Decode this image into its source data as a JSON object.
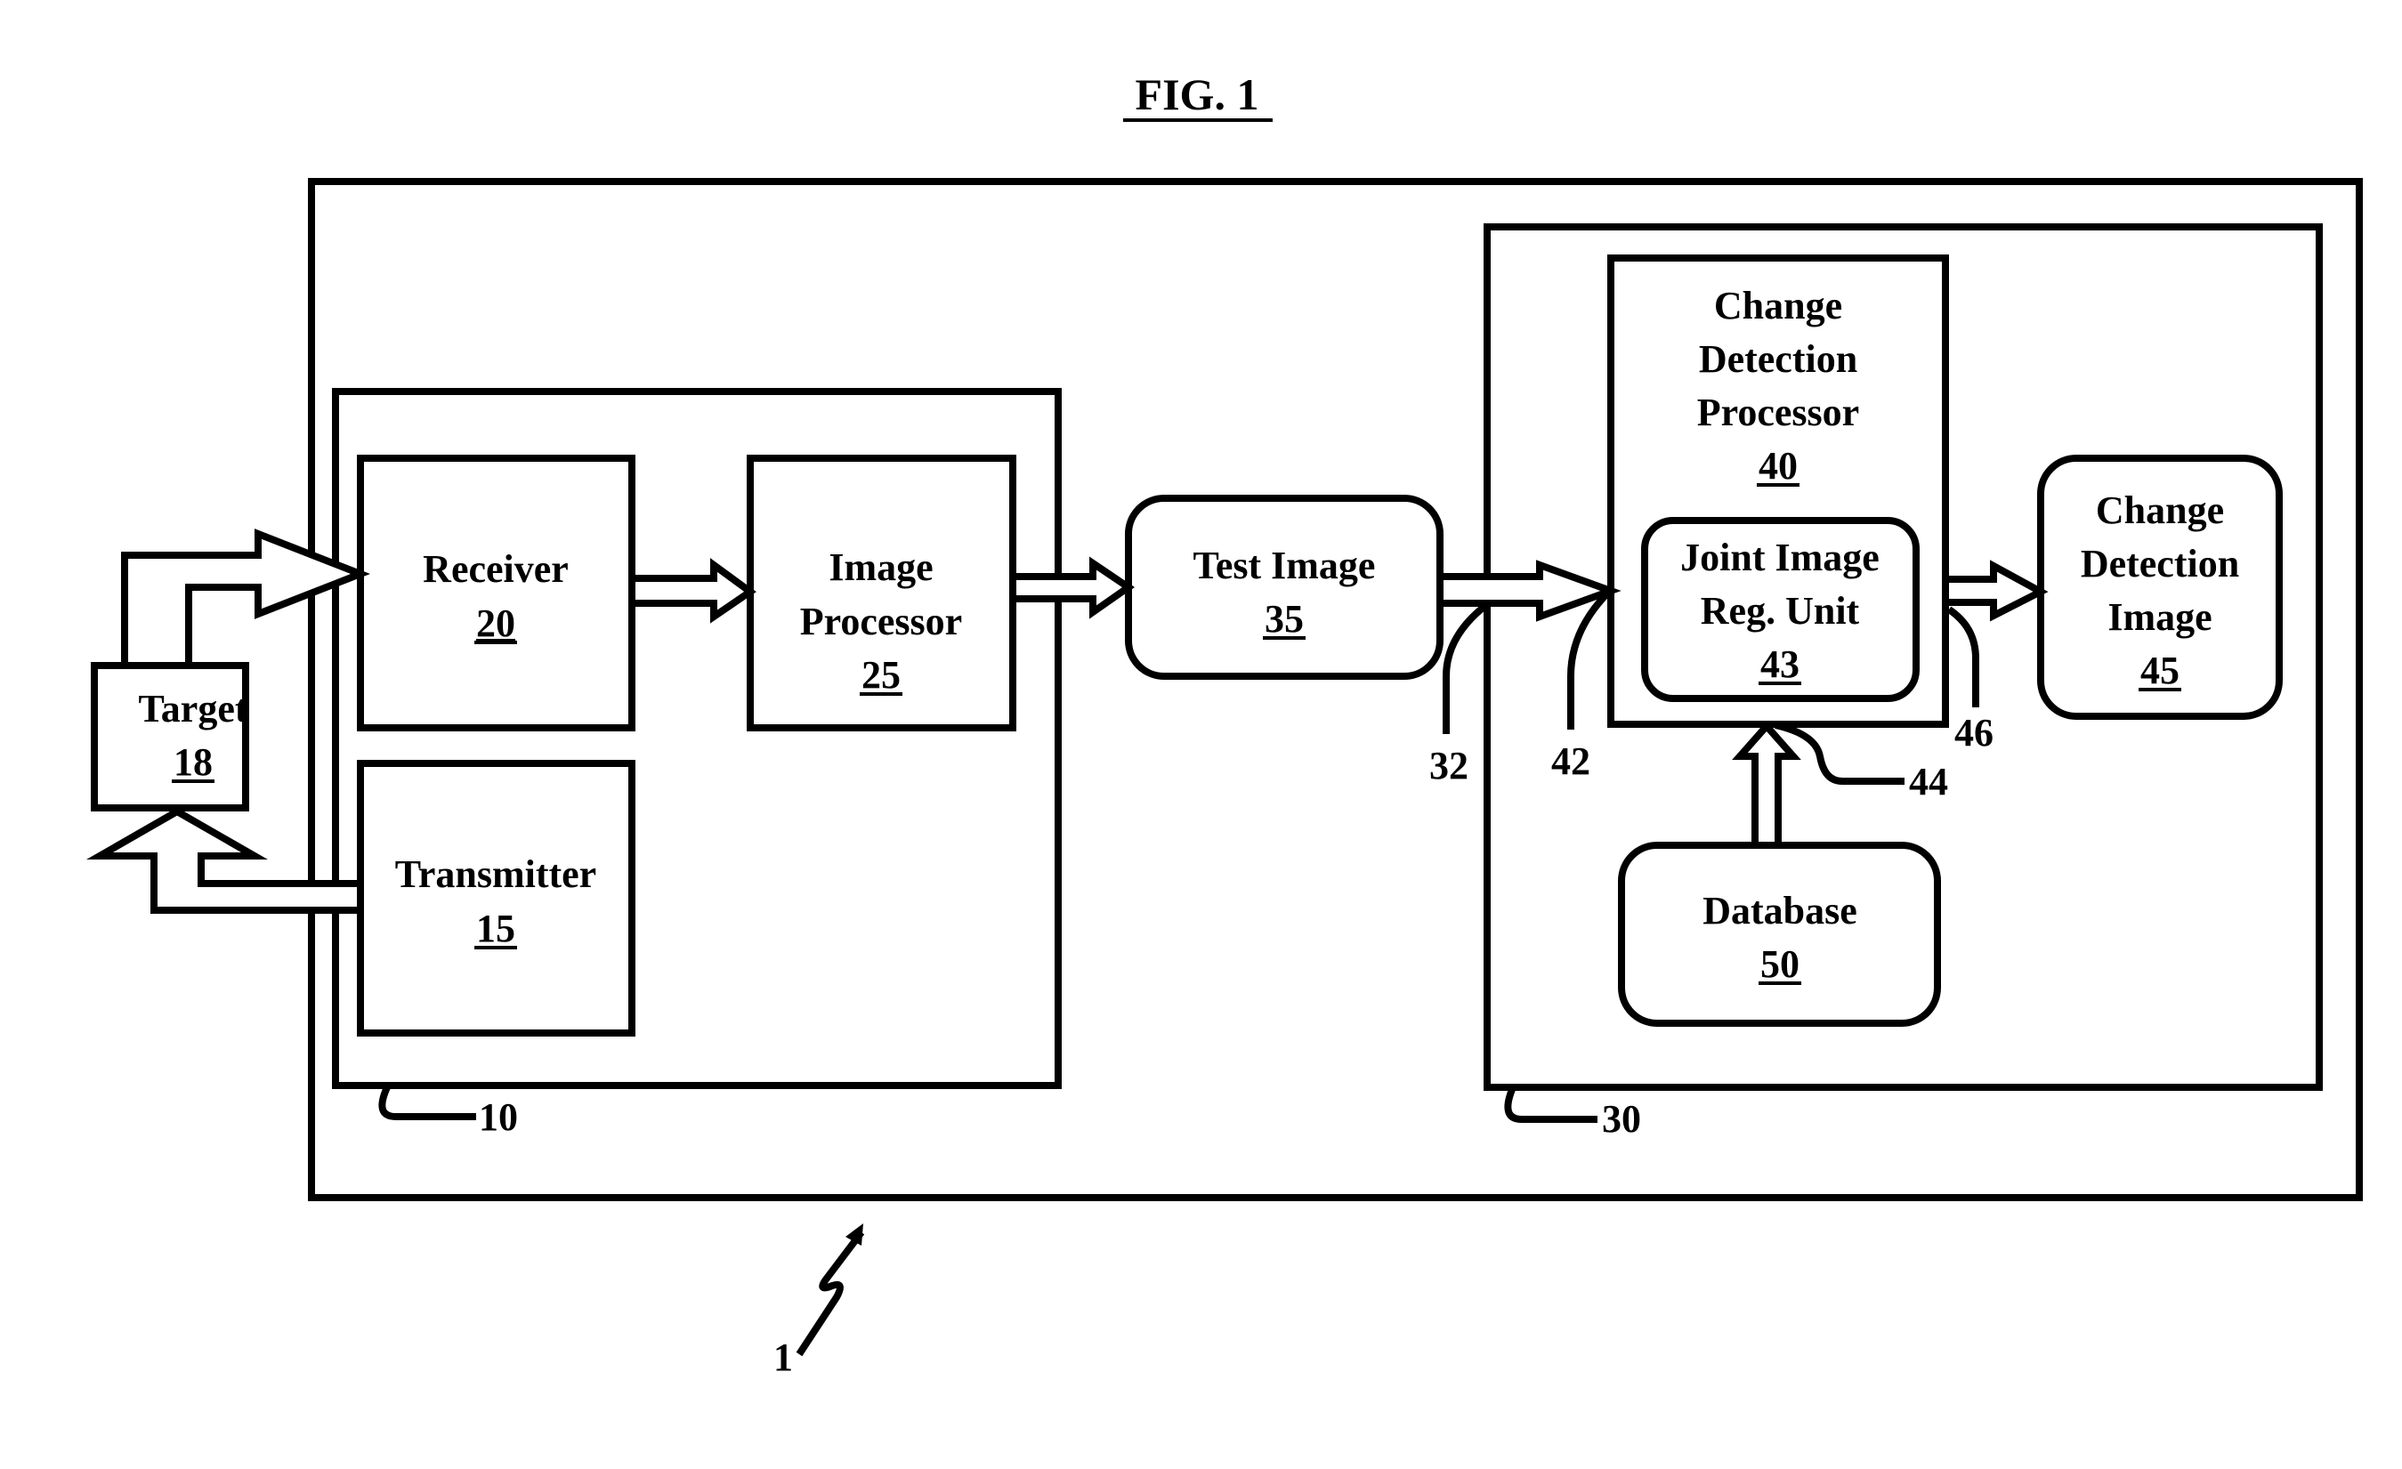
{
  "figure": {
    "title": "FIG. 1",
    "colors": {
      "ink": "#000000",
      "paper": "#ffffff"
    }
  },
  "blocks": {
    "target": {
      "lines": [
        "Target"
      ],
      "ref": "18"
    },
    "receiver": {
      "lines": [
        "Receiver"
      ],
      "ref": "20"
    },
    "transmitter": {
      "lines": [
        "Transmitter"
      ],
      "ref": "15"
    },
    "image_processor": {
      "lines": [
        "Image",
        "Processor"
      ],
      "ref": "25"
    },
    "test_image": {
      "lines": [
        "Test Image"
      ],
      "ref": "35"
    },
    "change_detection_processor": {
      "lines": [
        "Change",
        "Detection",
        "Processor"
      ],
      "ref": "40"
    },
    "joint_image_reg_unit": {
      "lines": [
        "Joint Image",
        "Reg. Unit"
      ],
      "ref": "43"
    },
    "change_detection_image": {
      "lines": [
        "Change",
        "Detection",
        "Image"
      ],
      "ref": "45"
    },
    "database": {
      "lines": [
        "Database"
      ],
      "ref": "50"
    }
  },
  "reference_labels": {
    "system": "1",
    "sensor_unit": "10",
    "processing_unit": "30",
    "link_32": "32",
    "link_42": "42",
    "link_44": "44",
    "link_46": "46"
  }
}
